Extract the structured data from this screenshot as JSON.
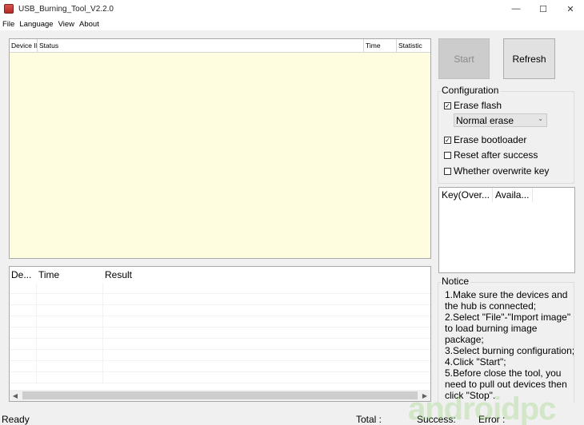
{
  "window": {
    "title": "USB_Burning_Tool_V2.2.0"
  },
  "window_controls": {
    "minimize": "—",
    "maximize": "☐",
    "close": "✕"
  },
  "menu": [
    "File",
    "Language",
    "View",
    "About"
  ],
  "device_list": {
    "columns": [
      "Device ID",
      "Status",
      "Time",
      "Statistic"
    ]
  },
  "result_list": {
    "columns": [
      "De...",
      "Time",
      "Result"
    ]
  },
  "buttons": {
    "start": "Start",
    "refresh": "Refresh"
  },
  "configuration": {
    "title": "Configuration",
    "erase_flash": {
      "label": "Erase flash",
      "checked": true
    },
    "erase_mode": "Normal erase",
    "erase_bootloader": {
      "label": "Erase bootloader",
      "checked": true
    },
    "reset_after_success": {
      "label": "Reset after success",
      "checked": false
    },
    "overwrite_key": {
      "label": "Whether overwrite key",
      "checked": false
    }
  },
  "key_list": {
    "columns": [
      "Key(Over...",
      "Availa..."
    ]
  },
  "notice": {
    "title": "Notice",
    "lines": [
      "1.Make sure the devices and",
      "the hub is connected;",
      "2.Select \"File\"-\"Import image\"",
      "to load burning image",
      "package;",
      "3.Select burning configuration;",
      "4.Click \"Start\";",
      "5.Before close the tool, you",
      "need to pull out devices then",
      "click \"Stop\"."
    ]
  },
  "status": {
    "ready": "Ready",
    "total": "Total :",
    "success": "Success:",
    "error": "Error :"
  },
  "watermark": "androidpc",
  "colors": {
    "list_background": "#fffde0",
    "disabled_button": "#cccccc",
    "watermark": "#78c850"
  }
}
